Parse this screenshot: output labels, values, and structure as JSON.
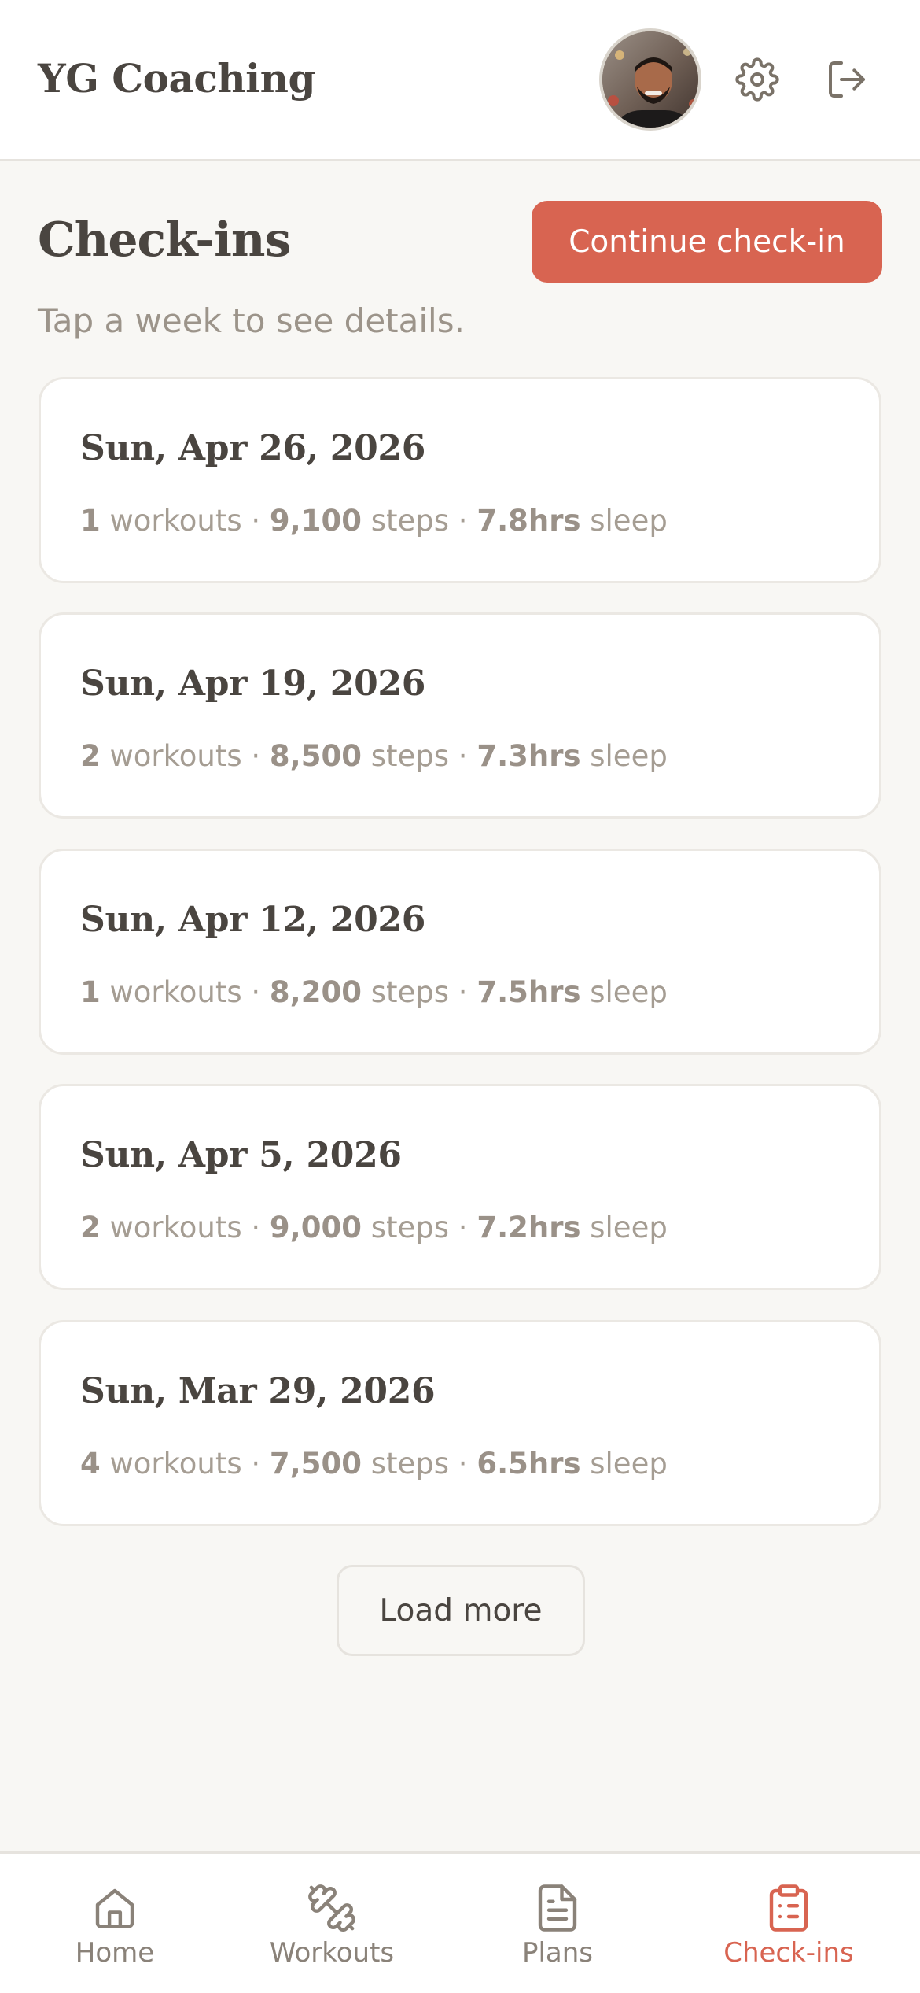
{
  "header": {
    "brand": "YG Coaching",
    "avatar_icon": "user-avatar",
    "settings_icon": "gear-icon",
    "logout_icon": "logout-icon"
  },
  "page": {
    "title": "Check-ins",
    "subtitle": "Tap a week to see details.",
    "continue_label": "Continue check-in",
    "accent_color": "#d86451"
  },
  "checkins": [
    {
      "date": "Sun, Apr 26, 2026",
      "workouts": "1",
      "workouts_label": "workouts",
      "steps": "9,100",
      "steps_label": "steps",
      "sleep": "7.8hrs",
      "sleep_label": "sleep"
    },
    {
      "date": "Sun, Apr 19, 2026",
      "workouts": "2",
      "workouts_label": "workouts",
      "steps": "8,500",
      "steps_label": "steps",
      "sleep": "7.3hrs",
      "sleep_label": "sleep"
    },
    {
      "date": "Sun, Apr 12, 2026",
      "workouts": "1",
      "workouts_label": "workouts",
      "steps": "8,200",
      "steps_label": "steps",
      "sleep": "7.5hrs",
      "sleep_label": "sleep"
    },
    {
      "date": "Sun, Apr 5, 2026",
      "workouts": "2",
      "workouts_label": "workouts",
      "steps": "9,000",
      "steps_label": "steps",
      "sleep": "7.2hrs",
      "sleep_label": "sleep"
    },
    {
      "date": "Sun, Mar 29, 2026",
      "workouts": "4",
      "workouts_label": "workouts",
      "steps": "7,500",
      "steps_label": "steps",
      "sleep": "6.5hrs",
      "sleep_label": "sleep"
    }
  ],
  "stat_separator": " · ",
  "load_more_label": "Load more",
  "nav": {
    "items": [
      {
        "label": "Home",
        "icon": "home-icon",
        "active": false
      },
      {
        "label": "Workouts",
        "icon": "dumbbell-icon",
        "active": false
      },
      {
        "label": "Plans",
        "icon": "document-icon",
        "active": false
      },
      {
        "label": "Check-ins",
        "icon": "clipboard-icon",
        "active": true
      }
    ]
  }
}
